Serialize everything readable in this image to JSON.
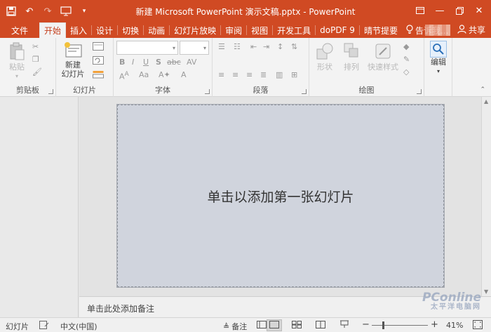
{
  "window": {
    "title": "新建 Microsoft PowerPoint 演示文稿.pptx - PowerPoint"
  },
  "qat": {
    "icons": [
      "save-icon",
      "undo-icon",
      "redo-icon",
      "start-from-beginning-icon",
      "customize-qat-icon"
    ]
  },
  "tabs": [
    {
      "label": "文件"
    },
    {
      "label": "开始",
      "active": true
    },
    {
      "label": "插入"
    },
    {
      "label": "设计"
    },
    {
      "label": "切换"
    },
    {
      "label": "动画"
    },
    {
      "label": "幻灯片放映"
    },
    {
      "label": "审阅"
    },
    {
      "label": "视图"
    },
    {
      "label": "开发工具"
    },
    {
      "label": "doPDF 9"
    },
    {
      "label": "晴节提要"
    }
  ],
  "tellme": {
    "label": "告诉我..."
  },
  "share": {
    "label": "共享"
  },
  "ribbon": {
    "clipboard": {
      "label": "剪贴板",
      "paste": "粘贴"
    },
    "slides": {
      "label": "幻灯片",
      "new_slide_line1": "新建",
      "new_slide_line2": "幻灯片"
    },
    "font": {
      "label": "字体"
    },
    "paragraph": {
      "label": "段落"
    },
    "drawing": {
      "label": "绘图",
      "shapes": "形状",
      "arrange": "排列",
      "quick_styles": "快速样式"
    },
    "editing": {
      "label": "编辑"
    }
  },
  "slide": {
    "title_placeholder": "单击以添加第一张幻灯片"
  },
  "notes": {
    "placeholder": "单击此处添加备注"
  },
  "status": {
    "slide_label": "幻灯片",
    "language": "中文(中国)",
    "notes_button": "备注",
    "zoom": "41%",
    "zoom_fraction": 0.41
  },
  "watermark": {
    "brand": "PConline",
    "tagline": "太平洋电脑网"
  },
  "colors": {
    "accent": "#d04a23",
    "ribbon_bg": "#f3f3f3",
    "slide_bg": "#d0d4dd"
  }
}
